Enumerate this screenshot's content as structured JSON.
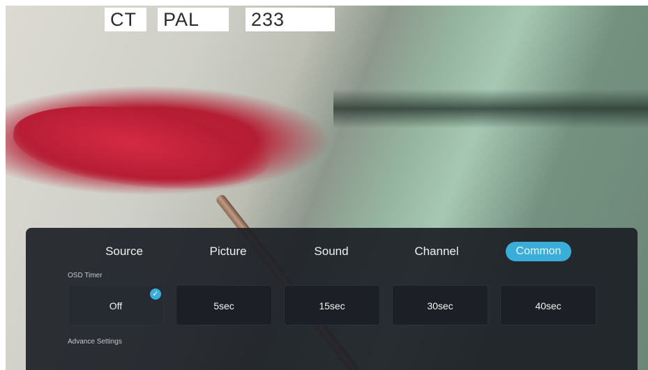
{
  "osd_banner": {
    "ct": "CT",
    "system": "PAL",
    "channel_number": "233"
  },
  "menu": {
    "tabs": [
      {
        "label": "Source"
      },
      {
        "label": "Picture"
      },
      {
        "label": "Sound"
      },
      {
        "label": "Channel"
      },
      {
        "label": "Common"
      }
    ],
    "active_tab": "Common",
    "osd_timer": {
      "label": "OSD Timer",
      "options": [
        "Off",
        "5sec",
        "15sec",
        "30sec",
        "40sec"
      ],
      "selected": "Off"
    },
    "advance_settings_label": "Advance Settings"
  },
  "colors": {
    "accent": "#3aaed8",
    "panel": "#1c2026"
  },
  "icons": {
    "selected_check": "check-icon"
  }
}
